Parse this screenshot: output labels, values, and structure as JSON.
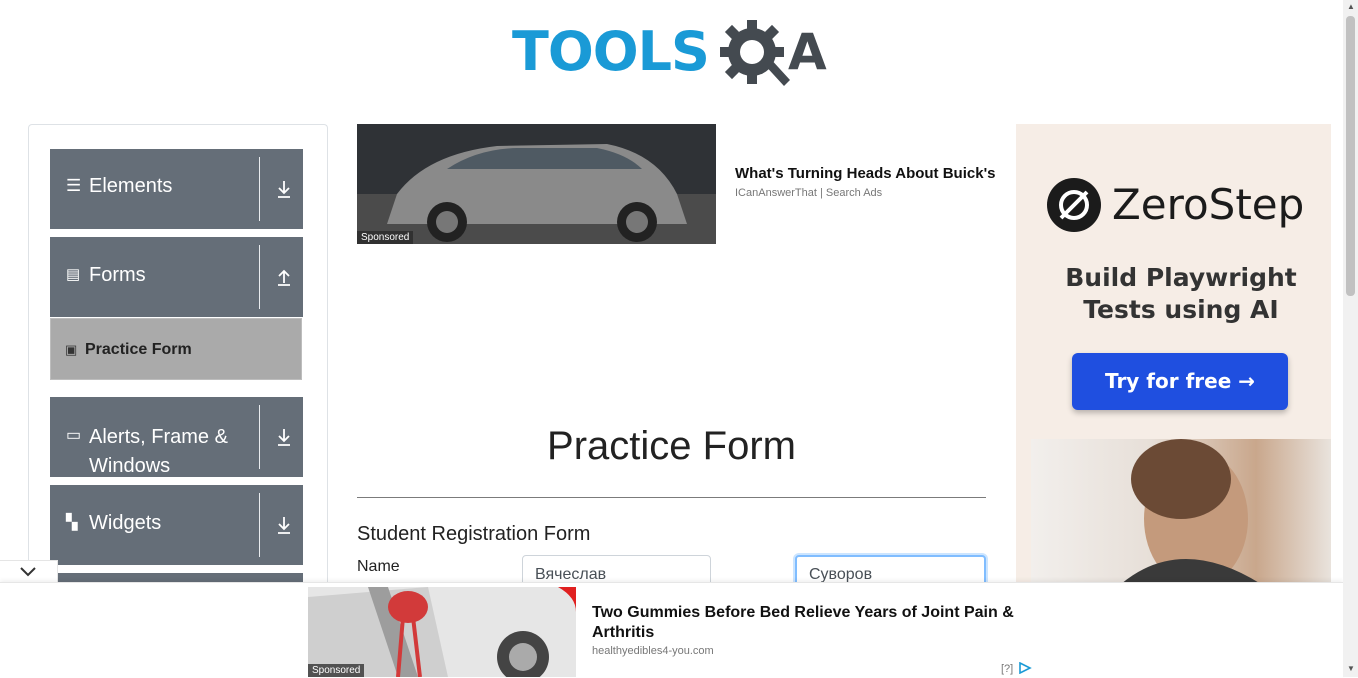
{
  "logo": {
    "text": "TOOLS",
    "suffix": "A"
  },
  "sidebar": {
    "groups": [
      {
        "label": "Elements",
        "icon": "hamburger-icon",
        "arrow": "download-icon"
      },
      {
        "label": "Forms",
        "icon": "document-icon",
        "arrow": "upload-icon"
      },
      {
        "label": "Alerts, Frame & Windows",
        "label_line1": "Alerts, Frame &",
        "label_line2": "Windows",
        "icon": "browser-window-icon",
        "arrow": "download-icon"
      },
      {
        "label": "Widgets",
        "icon": "widgets-icon",
        "arrow": "download-icon"
      }
    ],
    "active_item": "Practice Form"
  },
  "ad_top": {
    "title": "What's Turning Heads About Buick's",
    "source": "ICanAnswerThat | Search Ads",
    "sponsored": "Sponsored"
  },
  "ad_right": {
    "brand": "ZeroStep",
    "headline_line1": "Build Playwright",
    "headline_line2": "Tests using AI",
    "cta": "Try for free →"
  },
  "form": {
    "page_title": "Practice Form",
    "subtitle": "Student Registration Form",
    "name_label": "Name",
    "first_name_value": "Вячеслав",
    "last_name_value": "Суворов"
  },
  "ad_bottom": {
    "title": "Two Gummies Before Bed Relieve Years of Joint Pain & Arthritis",
    "source": "healthyedibles4-you.com",
    "sponsored": "Sponsored",
    "adchoice": "[?]"
  },
  "colors": {
    "sidebar_group": "#656e78",
    "active_item": "#aaaaaa",
    "logo_blue": "#1a9ad6",
    "cta_blue": "#1f4fe0"
  }
}
